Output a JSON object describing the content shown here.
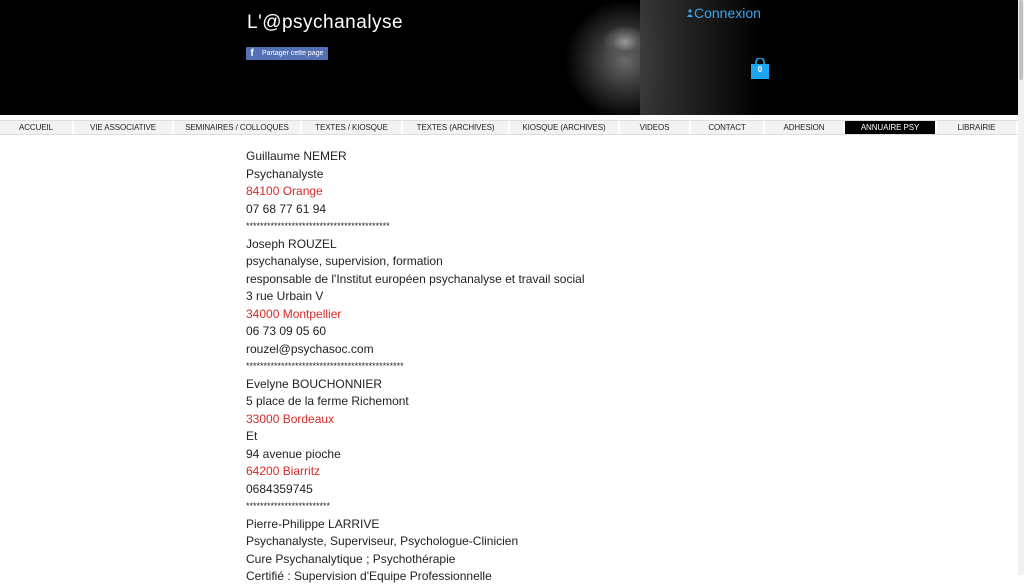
{
  "header": {
    "site_title": "L'@psychanalyse",
    "share_label": "Partager cette page",
    "share_icon": "facebook-icon",
    "login_label": "Connexion",
    "cart_count": "0",
    "login_color": "#3aa3ef",
    "cart_color": "#1ea7f0"
  },
  "nav": {
    "items": [
      {
        "label": "ACCUEIL",
        "active": false
      },
      {
        "label": "VIE ASSOCIATIVE",
        "active": false
      },
      {
        "label": "SEMINAIRES / COLLOQUES",
        "active": false
      },
      {
        "label": "TEXTES / KIOSQUE",
        "active": false
      },
      {
        "label": "TEXTES (ARCHIVES)",
        "active": false
      },
      {
        "label": "KIOSQUE (ARCHIVES)",
        "active": false
      },
      {
        "label": "VIDEOS",
        "active": false
      },
      {
        "label": "CONTACT",
        "active": false
      },
      {
        "label": "ADHESION",
        "active": false
      },
      {
        "label": "ANNUAIRE PSY",
        "active": true
      },
      {
        "label": "LIBRAIRIE",
        "active": false
      }
    ]
  },
  "directory": {
    "lines": [
      {
        "text": "Guillaume NEMER",
        "type": "normal"
      },
      {
        "text": "Psychanalyste",
        "type": "normal"
      },
      {
        "text": "84100 Orange",
        "type": "red"
      },
      {
        "text": "07 68 77 61 94",
        "type": "normal"
      },
      {
        "text": "*****************************************",
        "type": "sep"
      },
      {
        "text": "Joseph ROUZEL",
        "type": "normal"
      },
      {
        "text": "psychanalyse, supervision, formation",
        "type": "normal"
      },
      {
        "text": "responsable de l'Institut européen psychanalyse et travail social",
        "type": "normal"
      },
      {
        "text": "3 rue Urbain V",
        "type": "normal"
      },
      {
        "text": "34000 Montpellier",
        "type": "red"
      },
      {
        "text": "06 73 09 05 60",
        "type": "normal"
      },
      {
        "text": "rouzel@psychasoc.com",
        "type": "normal"
      },
      {
        "text": "*********************************************",
        "type": "sep"
      },
      {
        "text": "Evelyne BOUCHONNIER",
        "type": "normal"
      },
      {
        "text": "5 place de la ferme Richemont",
        "type": "normal"
      },
      {
        "text": "33000 Bordeaux",
        "type": "red"
      },
      {
        "text": "Et",
        "type": "normal"
      },
      {
        "text": "94 avenue pioche",
        "type": "normal"
      },
      {
        "text": "64200 Biarritz",
        "type": "red"
      },
      {
        "text": "0684359745",
        "type": "normal"
      },
      {
        "text": "************************",
        "type": "sep"
      },
      {
        "text": "Pierre-Philippe LARRIVE",
        "type": "normal"
      },
      {
        "text": "Psychanalyste, Superviseur, Psychologue-Clinicien",
        "type": "normal"
      },
      {
        "text": "Cure Psychanalytique ; Psychothérapie",
        "type": "normal"
      },
      {
        "text": "Certifié : Supervision d'Equipe  Professionnelle",
        "type": "normal"
      }
    ]
  }
}
